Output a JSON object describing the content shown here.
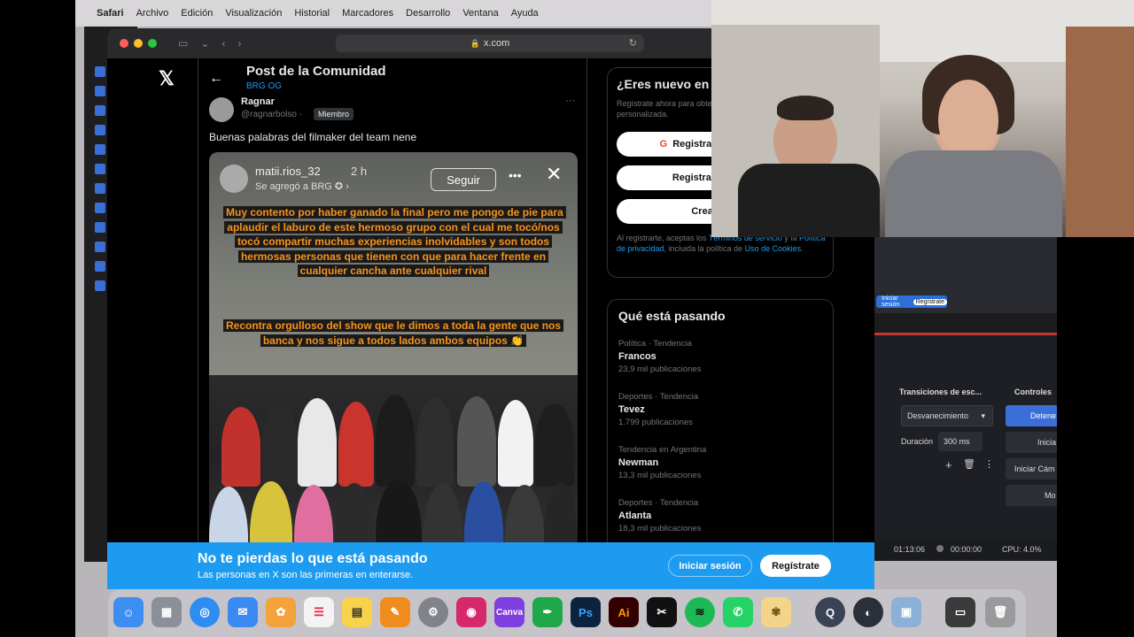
{
  "menubar": {
    "app": "Safari",
    "items": [
      "Archivo",
      "Edición",
      "Visualización",
      "Historial",
      "Marcadores",
      "Desarrollo",
      "Ventana",
      "Ayuda"
    ]
  },
  "browser": {
    "url": "x.com"
  },
  "post": {
    "header_title": "Post de la Comunidad",
    "header_sub": "BRG OG",
    "author_name": "Ragnar",
    "author_handle": "@ragnarbolso",
    "author_badge": "Miembro",
    "text": "Buenas palabras del filmaker del team nene",
    "story": {
      "user": "matii.rios_32",
      "time": "2 h",
      "added": "Se agregó a BRG",
      "follow": "Seguir",
      "caption1": "Muy contento por haber ganado la final pero me pongo de pie para aplaudir el laburo de este hermoso grupo con el cual me tocó/nos tocó compartir muchas experiencias inolvidables y son todos hermosas personas que tienen con que para hacer frente en cualquier cancha ante cualquier rival",
      "caption2": "Recontra orgulloso del show que le dimos a toda la gente que nos banca y nos sigue a todos lados ambos equipos 👏"
    }
  },
  "signup": {
    "title": "¿Eres nuevo en X?",
    "desc": "Regístrate ahora para obtener tu propia cronología personalizada.",
    "google": "Registrarse con Google",
    "apple": "Registrarse con Apple",
    "create": "Crear cuenta",
    "legal_prefix": "Al registrarte, aceptas los ",
    "legal_terms": "Términos de servicio",
    "legal_mid": " y la ",
    "legal_privacy": "Política de privacidad",
    "legal_mid2": ", incluida la política de ",
    "legal_cookies": "Uso de Cookies",
    "legal_end": "."
  },
  "trends": {
    "title": "Qué está pasando",
    "items": [
      {
        "category": "Política · Tendencia",
        "name": "Francos",
        "count": "23,9 mil publicaciones"
      },
      {
        "category": "Deportes · Tendencia",
        "name": "Tevez",
        "count": "1.799 publicaciones"
      },
      {
        "category": "Tendencia en Argentina",
        "name": "Newman",
        "count": "13,3 mil publicaciones"
      },
      {
        "category": "Deportes · Tendencia",
        "name": "Atlanta",
        "count": "18,3 mil publicaciones"
      }
    ]
  },
  "banner": {
    "title": "No te pierdas lo que está pasando",
    "sub": "Las personas en X son las primeras en enterarse.",
    "login": "Iniciar sesión",
    "register": "Regístrate"
  },
  "obs": {
    "transitions": "Transiciones de esc...",
    "controls": "Controles",
    "transition_value": "Desvanecimiento",
    "duration_label": "Duración",
    "duration_value": "300 ms",
    "btn_stop": "Detene",
    "btn_start": "Inicia",
    "btn_cam": "Iniciar Cám",
    "btn_mode": "Mo",
    "status_time": "01:13:06",
    "status_rec": "00:00:00",
    "status_cpu": "CPU: 4.0%",
    "mini_login": "Iniciar sesión",
    "mini_reg": "Regístrate"
  },
  "dock": {
    "icons": [
      "finder-icon",
      "launchpad-icon",
      "safari-icon",
      "mail-icon",
      "photos-icon",
      "reminders-icon",
      "notes-icon",
      "pages-icon",
      "settings-icon",
      "instagram-icon",
      "canva-icon",
      "feather-icon",
      "photoshop-icon",
      "illustrator-icon",
      "capcut-icon",
      "spotify-icon",
      "whatsapp-icon",
      "paw-icon",
      "quicktime-icon",
      "obs-icon",
      "preview-icon",
      "photobooth-icon",
      "trash-icon"
    ],
    "labels": {
      "canva": "Canva",
      "ps": "Ps",
      "ai": "Ai"
    }
  }
}
